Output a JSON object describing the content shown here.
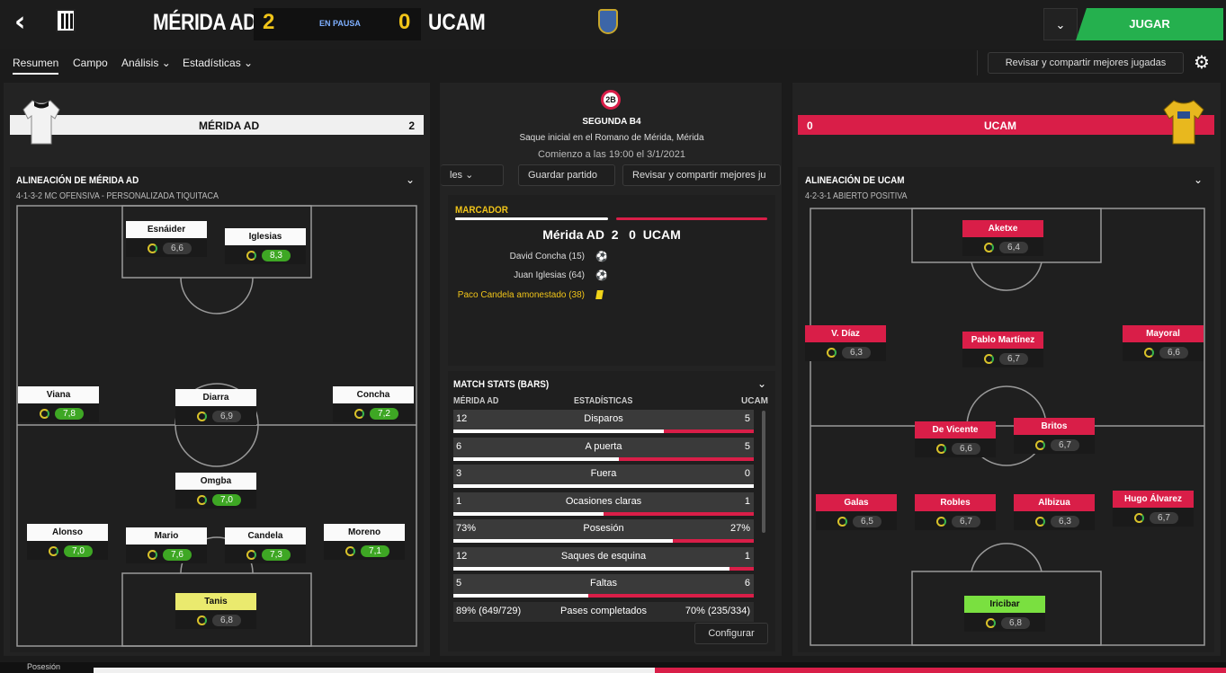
{
  "header": {
    "home": "MÉRIDA AD",
    "away": "UCAM",
    "home_score": "2",
    "away_score": "0",
    "status": "EN PAUSA",
    "play_label": "JUGAR"
  },
  "tabs": [
    "Resumen",
    "Campo",
    "Análisis",
    "Estadísticas"
  ],
  "review_btn": "Revisar y compartir mejores jugadas",
  "home_bar": {
    "name": "MÉRIDA AD",
    "score": "2"
  },
  "away_bar": {
    "name": "UCAM",
    "score": "0"
  },
  "center": {
    "league": "SEGUNDA B4",
    "venue": "Saque inicial en el Romano de Mérida, Mérida",
    "kickoff": "Comienzo a las 19:00 el 3/1/2021",
    "btn_les": "les",
    "btn_save": "Guardar partido",
    "btn_review": "Revisar y compartir mejores ju"
  },
  "marcador": {
    "title": "MARCADOR",
    "line": "Mérida AD  2   0  UCAM",
    "events": [
      "David Concha (15)",
      "Juan Iglesias (64)",
      "Paco Candela amonestado (38)"
    ]
  },
  "stats": {
    "title": "MATCH STATS (BARS)",
    "home": "MÉRIDA AD",
    "mid": "ESTADÍSTICAS",
    "away": "UCAM",
    "configure": "Configurar",
    "rows": [
      {
        "l": "12",
        "c": "Disparos",
        "r": "5",
        "p": 0.7
      },
      {
        "l": "6",
        "c": "A puerta",
        "r": "5",
        "p": 0.55
      },
      {
        "l": "3",
        "c": "Fuera",
        "r": "0",
        "p": 1.0
      },
      {
        "l": "1",
        "c": "Ocasiones claras",
        "r": "1",
        "p": 0.5
      },
      {
        "l": "73%",
        "c": "Posesión",
        "r": "27%",
        "p": 0.73
      },
      {
        "l": "12",
        "c": "Saques de esquina",
        "r": "1",
        "p": 0.92
      },
      {
        "l": "5",
        "c": "Faltas",
        "r": "6",
        "p": 0.45
      },
      {
        "l": "89% (649/729)",
        "c": "Pases completados",
        "r": "70% (235/334)",
        "p": 0.5
      }
    ]
  },
  "home_lineup": {
    "title": "ALINEACIÓN DE MÉRIDA AD",
    "formation": "4-1-3-2 MC OFENSIVA - PERSONALIZADA TIQUITACA",
    "players": [
      {
        "n": "Esnáider",
        "r": "6,6",
        "good": false
      },
      {
        "n": "Iglesias",
        "r": "8,3",
        "good": true
      },
      {
        "n": "Viana",
        "r": "7,8",
        "good": true
      },
      {
        "n": "Diarra",
        "r": "6,9",
        "good": false
      },
      {
        "n": "Concha",
        "r": "7,2",
        "good": true
      },
      {
        "n": "Omgba",
        "r": "7,0",
        "good": true
      },
      {
        "n": "Alonso",
        "r": "7,0",
        "good": true
      },
      {
        "n": "Mario",
        "r": "7,6",
        "good": true
      },
      {
        "n": "Candela",
        "r": "7,3",
        "good": true
      },
      {
        "n": "Moreno",
        "r": "7,1",
        "good": true
      },
      {
        "n": "Tanis",
        "r": "6,8",
        "good": false
      }
    ]
  },
  "away_lineup": {
    "title": "ALINEACIÓN DE UCAM",
    "formation": "4-2-3-1 ABIERTO POSITIVA",
    "players": [
      {
        "n": "Aketxe",
        "r": "6,4"
      },
      {
        "n": "V. Díaz",
        "r": "6,3"
      },
      {
        "n": "Pablo Martínez",
        "r": "6,7"
      },
      {
        "n": "Mayoral",
        "r": "6,6"
      },
      {
        "n": "De Vicente",
        "r": "6,6"
      },
      {
        "n": "Britos",
        "r": "6,7"
      },
      {
        "n": "Galas",
        "r": "6,5"
      },
      {
        "n": "Robles",
        "r": "6,7"
      },
      {
        "n": "Albizua",
        "r": "6,3"
      },
      {
        "n": "Hugo Álvarez",
        "r": "6,7"
      },
      {
        "n": "Iricibar",
        "r": "6,8"
      }
    ]
  },
  "bottom": {
    "label": "Posesión"
  }
}
